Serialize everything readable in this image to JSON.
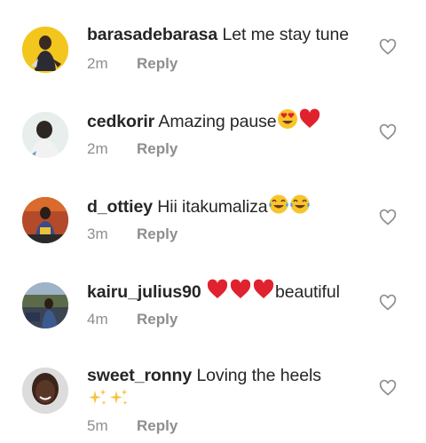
{
  "comments": [
    {
      "username": "barasadebarasa",
      "text": "Let me stay tune",
      "emoji": [],
      "time": "2m",
      "reply_label": "Reply"
    },
    {
      "username": "cedkorir",
      "text": "Amazing pause",
      "emoji": [
        "heart-eyes-emoji",
        "red-heart-emoji"
      ],
      "time": "2m",
      "reply_label": "Reply"
    },
    {
      "username": "d_ottiey",
      "text": "Hii itakumaliza",
      "emoji": [
        "tears-of-joy-emoji",
        "tears-of-joy-emoji"
      ],
      "time": "3m",
      "reply_label": "Reply"
    },
    {
      "username": "kairu_julius90",
      "text": "beautiful",
      "emoji": [
        "red-heart-emoji",
        "red-heart-emoji",
        "red-heart-emoji"
      ],
      "time": "4m",
      "reply_label": "Reply"
    },
    {
      "username": "sweet_ronny",
      "text": "Loving the heels",
      "emoji": [
        "sparkles-emoji",
        "sparkles-emoji"
      ],
      "time": "5m",
      "reply_label": "Reply"
    }
  ],
  "colors": {
    "text": "#262626",
    "meta": "#8e8e8e",
    "heart": "#e0222f",
    "emoji_face": "#f7c52b",
    "sparkle": "#f5c542"
  }
}
